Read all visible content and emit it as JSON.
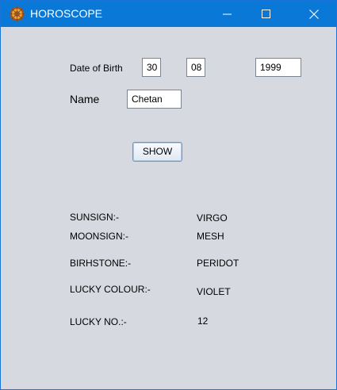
{
  "window": {
    "title": "HOROSCOPE",
    "icon": "zodiac-wheel-icon",
    "controls": [
      "minimize-icon",
      "maximize-icon",
      "close-icon"
    ]
  },
  "form": {
    "dob_label": "Date of Birth",
    "day": "30",
    "month": "08",
    "year": "1999",
    "name_label": "Name",
    "name": "Chetan",
    "show_button": "SHOW"
  },
  "results": [
    {
      "label": "SUNSIGN:-",
      "value": "VIRGO"
    },
    {
      "label": "MOONSIGN:-",
      "value": "MESH"
    },
    {
      "label": "BIRHSTONE:-",
      "value": "PERIDOT"
    },
    {
      "label": "LUCKY COLOUR:-",
      "value": "VIOLET"
    },
    {
      "label": "LUCKY NO.:-",
      "value": "12"
    }
  ],
  "colors": {
    "titlebar": "#0a78d7",
    "background": "#d6d9df"
  }
}
